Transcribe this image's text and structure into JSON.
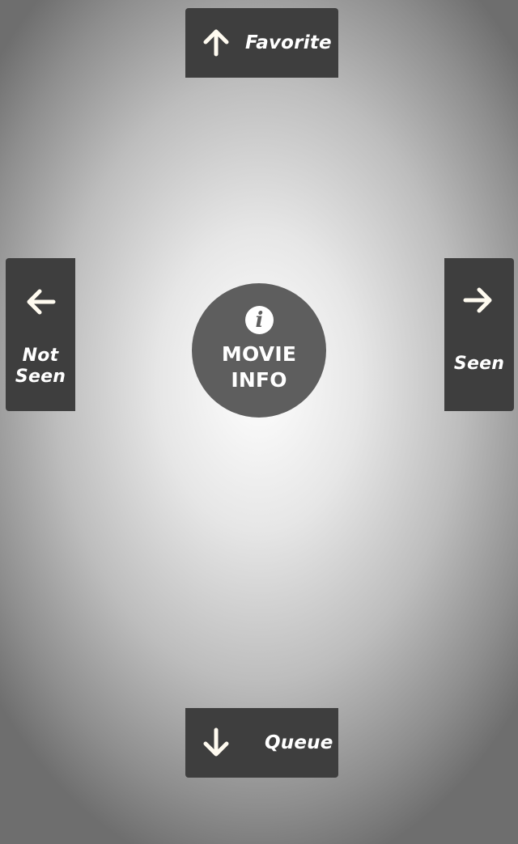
{
  "actions": {
    "favorite": {
      "label": "Favorite",
      "icon": "arrow-up-icon"
    },
    "queue": {
      "label": "Queue",
      "icon": "arrow-down-icon"
    },
    "not_seen": {
      "label": "Not\nSeen",
      "icon": "arrow-left-icon"
    },
    "seen": {
      "label": "Seen",
      "icon": "arrow-right-icon"
    }
  },
  "center": {
    "icon_glyph": "i",
    "icon": "info-icon",
    "label": "MOVIE\nINFO"
  },
  "colors": {
    "panel": "#3e3e3e",
    "circle": "#5e5e5e",
    "text": "#ffffff",
    "arrow": "#fffbf0"
  }
}
